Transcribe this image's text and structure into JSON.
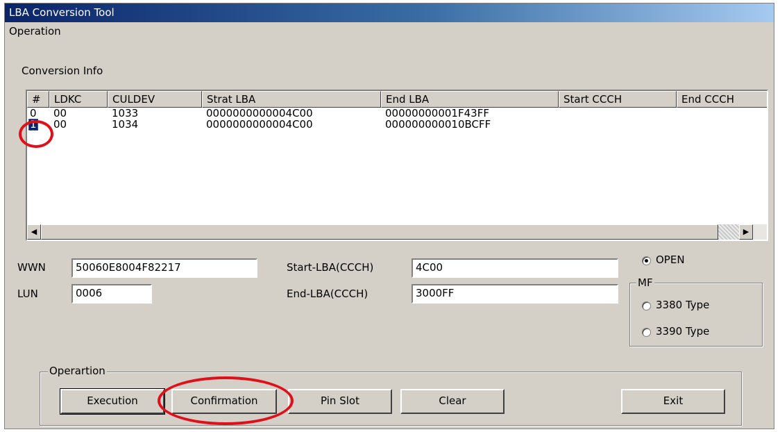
{
  "window": {
    "title": "LBA Conversion Tool"
  },
  "menu": {
    "operation": "Operation"
  },
  "conversion_info": {
    "label": "Conversion Info",
    "columns": [
      "#",
      "LDKC",
      "CULDEV",
      "Strat LBA",
      "End LBA",
      "Start CCCH",
      "End CCCH"
    ],
    "rows": [
      {
        "num": "0",
        "ldkc": "00",
        "culdev": "1033",
        "start_lba": "0000000000004C00",
        "end_lba": "00000000001F43FF"
      },
      {
        "num": "1",
        "ldkc": "00",
        "culdev": "1034",
        "start_lba": "0000000000004C00",
        "end_lba": "000000000010BCFF"
      }
    ],
    "selected_row": 1
  },
  "fields": {
    "wwn": {
      "label": "WWN",
      "value": "50060E8004F82217"
    },
    "lun": {
      "label": "LUN",
      "value": "0006"
    },
    "start_lba": {
      "label": "Start-LBA(CCCH)",
      "value": "4C00"
    },
    "end_lba": {
      "label": "End-LBA(CCCH)",
      "value": "3000FF"
    }
  },
  "type_select": {
    "open_label": "OPEN",
    "mf_label": "MF",
    "type3380_label": "3380 Type",
    "type3390_label": "3390 Type",
    "selected": "OPEN"
  },
  "operation_group": {
    "label": "Operartion",
    "execution": "Execution",
    "confirmation": "Confirmation",
    "pin_slot": "Pin Slot",
    "clear": "Clear",
    "exit": "Exit"
  },
  "colors": {
    "annotation": "#e0101a",
    "title_bar": "#0a246a",
    "window_bg": "#d4d0c8",
    "selection": "#0a246a"
  }
}
